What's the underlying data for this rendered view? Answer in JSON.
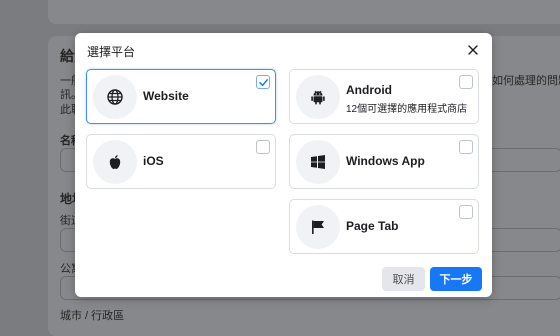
{
  "background": {
    "heading": "給資",
    "desc_line1": "一般",
    "desc_line1_right": "如何處理的問題",
    "desc_line2": "訊。",
    "desc_line3": "此聯",
    "field_name": "名稱",
    "section_address": "地址",
    "field_street": "街道",
    "field_apartment": "公寓",
    "field_city": "城市 / 行政區"
  },
  "modal": {
    "title": "選擇平台",
    "cancel_label": "取消",
    "next_label": "下一步"
  },
  "platforms": [
    {
      "label": "Website",
      "sublabel": "",
      "icon": "globe-icon",
      "selected": true
    },
    {
      "label": "Android",
      "sublabel": "12個可選擇的應用程式商店",
      "icon": "android-icon",
      "selected": false
    },
    {
      "label": "iOS",
      "sublabel": "",
      "icon": "apple-icon",
      "selected": false
    },
    {
      "label": "Windows App",
      "sublabel": "",
      "icon": "windows-icon",
      "selected": false
    },
    {
      "label": "Page Tab",
      "sublabel": "",
      "icon": "flag-icon",
      "selected": false
    }
  ],
  "colors": {
    "primary": "#1877f2",
    "selected_border": "#4a90e2",
    "overlay": "#7b7c7f"
  }
}
